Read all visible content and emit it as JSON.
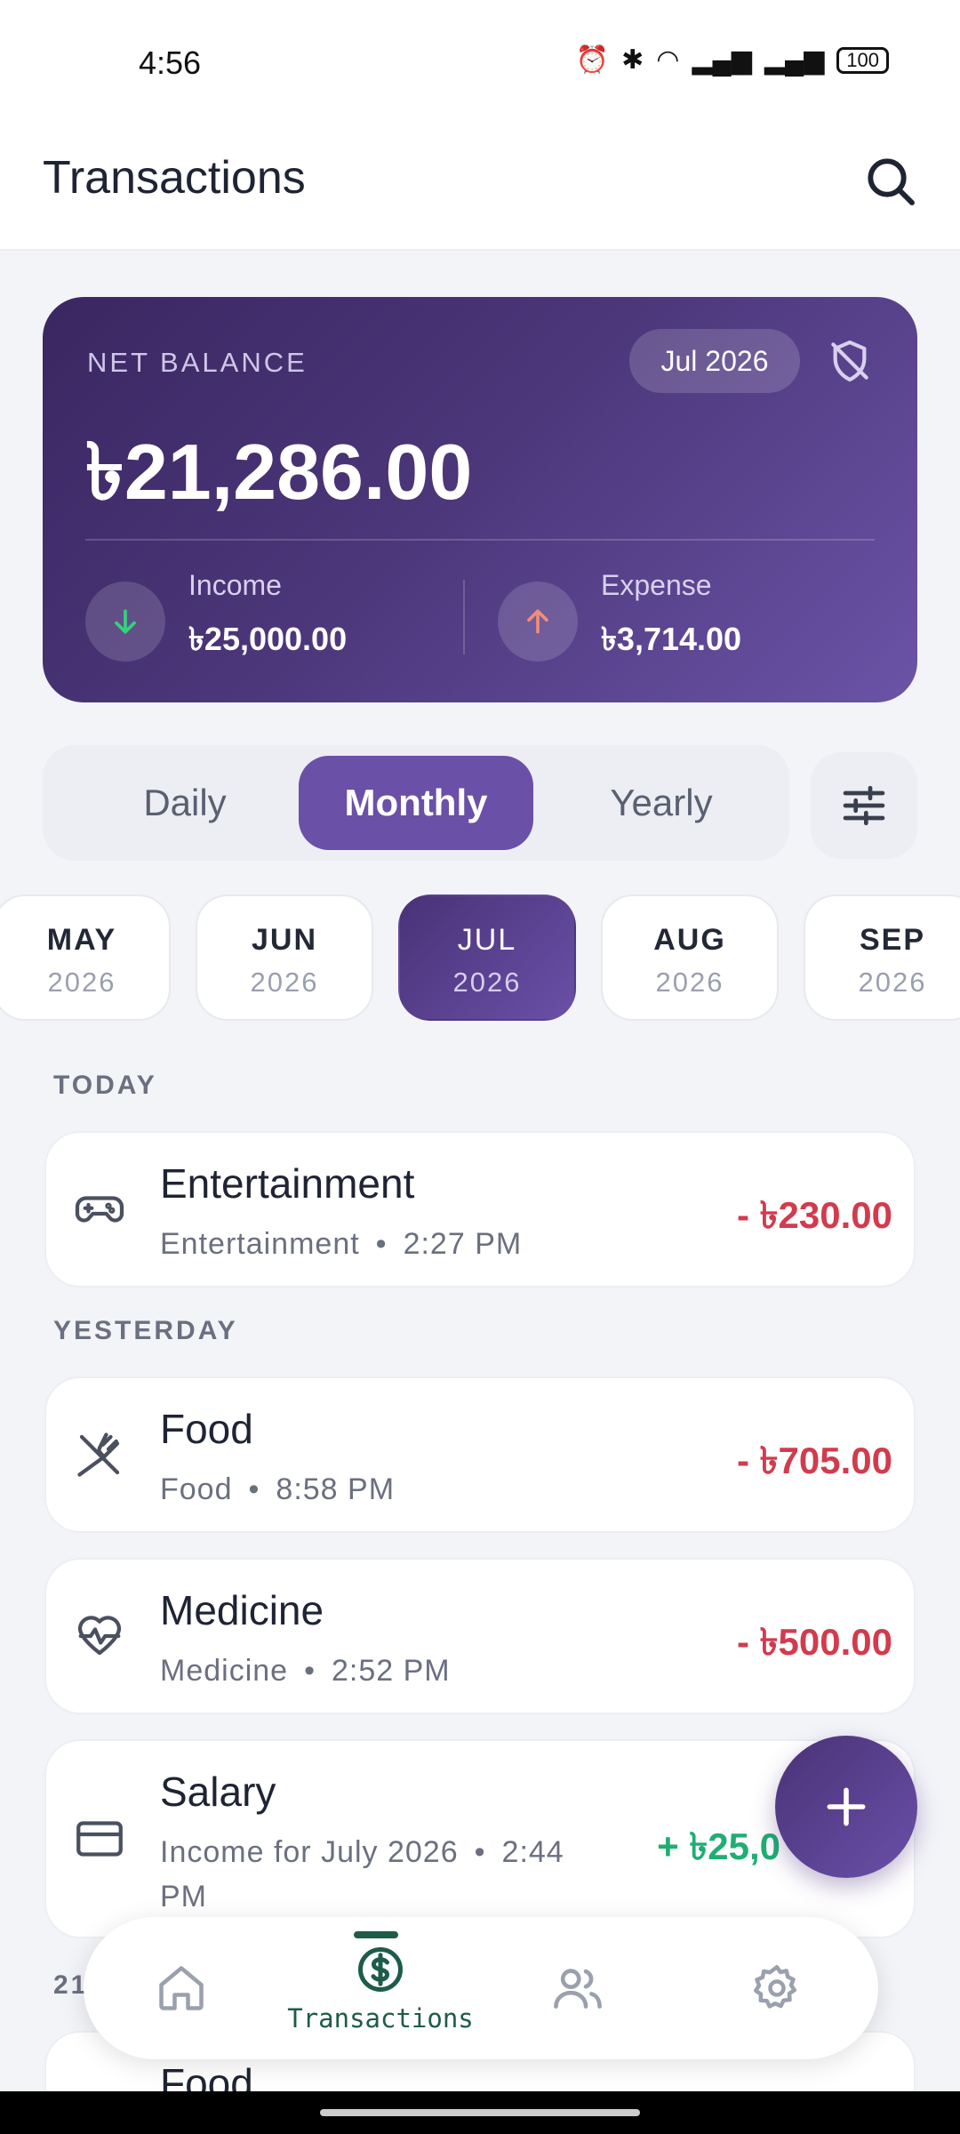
{
  "status_bar": {
    "time": "4:56",
    "battery": "100"
  },
  "header": {
    "title": "Transactions"
  },
  "balance": {
    "label": "NET BALANCE",
    "period": "Jul 2026",
    "amount": "৳21,286.00",
    "income_label": "Income",
    "income_value": "৳25,000.00",
    "expense_label": "Expense",
    "expense_value": "৳3,714.00"
  },
  "period_tabs": [
    "Daily",
    "Monthly",
    "Yearly"
  ],
  "active_period": "Monthly",
  "months": [
    {
      "m": "MAY",
      "y": "2026"
    },
    {
      "m": "JUN",
      "y": "2026"
    },
    {
      "m": "JUL",
      "y": "2026"
    },
    {
      "m": "AUG",
      "y": "2026"
    },
    {
      "m": "SEP",
      "y": "2026"
    }
  ],
  "sections": {
    "today": "TODAY",
    "yesterday": "YESTERDAY",
    "older": "21"
  },
  "transactions": [
    {
      "title": "Entertainment",
      "category": "Entertainment",
      "time": "2:27 PM",
      "amount": "- ৳230.00",
      "type": "expense",
      "icon": "gamepad-icon"
    },
    {
      "title": "Food",
      "category": "Food",
      "time": "8:58 PM",
      "amount": "- ৳705.00",
      "type": "expense",
      "icon": "fork-knife-icon"
    },
    {
      "title": "Medicine",
      "category": "Medicine",
      "time": "2:52 PM",
      "amount": "- ৳500.00",
      "type": "expense",
      "icon": "heartbeat-icon"
    },
    {
      "title": "Salary",
      "category": "Income for July 2026",
      "time": "2:44",
      "time_wrap": "PM",
      "amount": "+ ৳25,0",
      "type": "income",
      "icon": "credit-card-icon"
    },
    {
      "title": "Food",
      "icon": "fork-knife-icon"
    }
  ],
  "bottom_nav": {
    "active_label": "Transactions"
  },
  "colors": {
    "accent": "#6a50a7",
    "expense": "#d23b4e",
    "income": "#1fae73",
    "nav_active": "#1e5c4a"
  }
}
